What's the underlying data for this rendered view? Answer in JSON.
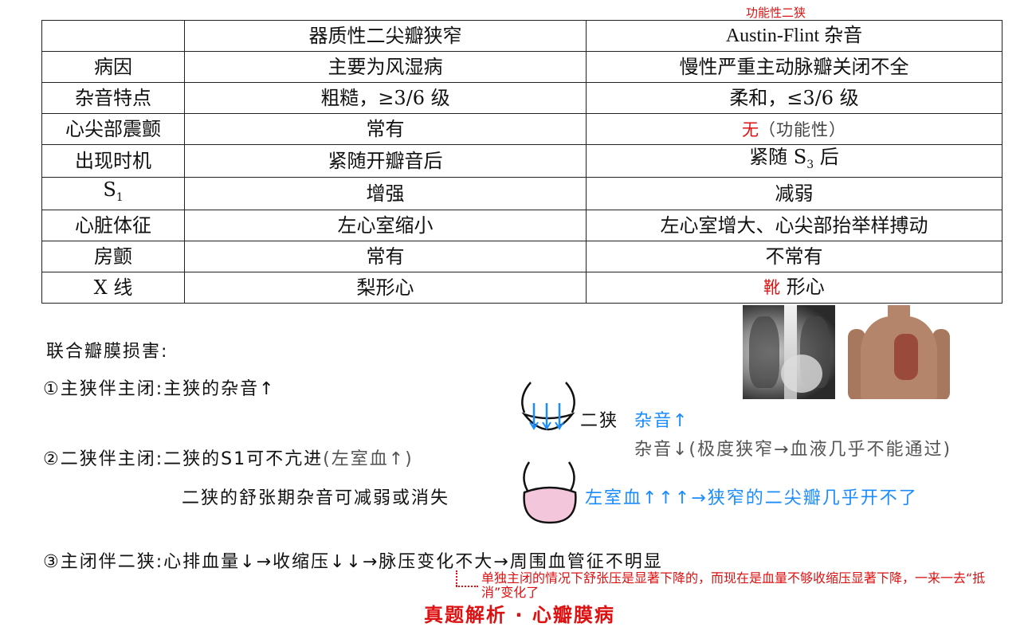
{
  "top_annotation": "功能性二狭",
  "table": {
    "header": [
      "",
      "器质性二尖瓣狭窄",
      "Austin-Flint 杂音"
    ],
    "rows": [
      {
        "label": "病因",
        "a": "主要为风湿病",
        "b": "慢性严重主动脉瓣关闭不全"
      },
      {
        "label": "杂音特点",
        "a": "粗糙，≥3/6 级",
        "b": "柔和，≤3/6 级"
      },
      {
        "label": "心尖部震颤",
        "a": "常有",
        "b_red": "无",
        "b_note": "（功能性）"
      },
      {
        "label_main": "出现时机",
        "a": "紧随开瓣音后",
        "b_pre": "紧随 S",
        "b_sub": "3",
        "b_post": " 后"
      },
      {
        "label_pre": "S",
        "label_sub": "1",
        "a": "增强",
        "b": "减弱"
      },
      {
        "label": "心脏体征",
        "a": "左心室缩小",
        "b": "左心室增大、心尖部抬举样搏动"
      },
      {
        "label": "房颤",
        "a": "常有",
        "b": "不常有"
      },
      {
        "label": "X 线",
        "a": "梨形心",
        "b_red": "靴",
        "b_post": " 形心"
      }
    ]
  },
  "notes": {
    "heading": "联合瓣膜损害:",
    "item1": "①主狭伴主闭:主狭的杂音↑",
    "item2": "②二狭伴主闭:二狭的S1可不亢进",
    "item2_gray": "(左室血↑)",
    "item2_sub": "二狭的舒张期杂音可减弱或消失",
    "item3": "③主闭伴二狭:心排血量↓→收缩压↓↓→脉压变化不大→周围血管征不明显",
    "diagram_label": "二狭",
    "murmur_up": "杂音↑",
    "murmur_down": "杂音↓(极度狭窄→血液几乎不能通过)",
    "lv_blood": "左室血↑↑↑→狭窄的二尖瓣几乎开不了"
  },
  "bottom_note": "单独主闭的情况下舒张压是显著下降的，而现在是血量不够收缩压显著下降，一来一去“抵消”变化了",
  "footer_title": "真题解析 · 心瓣膜病",
  "colors": {
    "red": "#d11111",
    "blue": "#1a8cff",
    "pink": "#f4c6dc"
  }
}
